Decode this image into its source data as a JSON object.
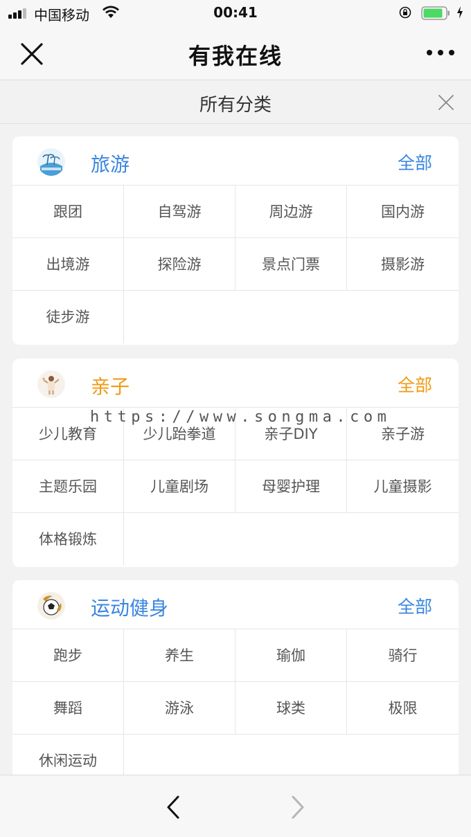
{
  "status_bar": {
    "carrier": "中国移动",
    "time": "00:41"
  },
  "nav": {
    "title": "有我在线"
  },
  "sub_header": {
    "title": "所有分类"
  },
  "colors": {
    "blue_accent": "#3a86e0",
    "orange_accent": "#f19a14"
  },
  "categories": [
    {
      "title": "旅游",
      "all_label": "全部",
      "accent": "blue",
      "icon": "travel-logo-icon",
      "items": [
        "跟团",
        "自驾游",
        "周边游",
        "国内游",
        "出境游",
        "探险游",
        "景点门票",
        "摄影游",
        "徒步游"
      ]
    },
    {
      "title": "亲子",
      "all_label": "全部",
      "accent": "orange",
      "icon": "parent-child-logo-icon",
      "items": [
        "少儿教育",
        "少儿跆拳道",
        "亲子DIY",
        "亲子游",
        "主题乐园",
        "儿童剧场",
        "母婴护理",
        "儿童摄影",
        "体格锻炼"
      ]
    },
    {
      "title": "运动健身",
      "all_label": "全部",
      "accent": "blue",
      "icon": "sports-logo-icon",
      "items": [
        "跑步",
        "养生",
        "瑜伽",
        "骑行",
        "舞蹈",
        "游泳",
        "球类",
        "极限",
        "休闲运动"
      ]
    }
  ],
  "watermark": "https://www.songma.com",
  "toolbar": {
    "back_icon": "chevron-left-icon",
    "forward_icon": "chevron-right-icon"
  }
}
